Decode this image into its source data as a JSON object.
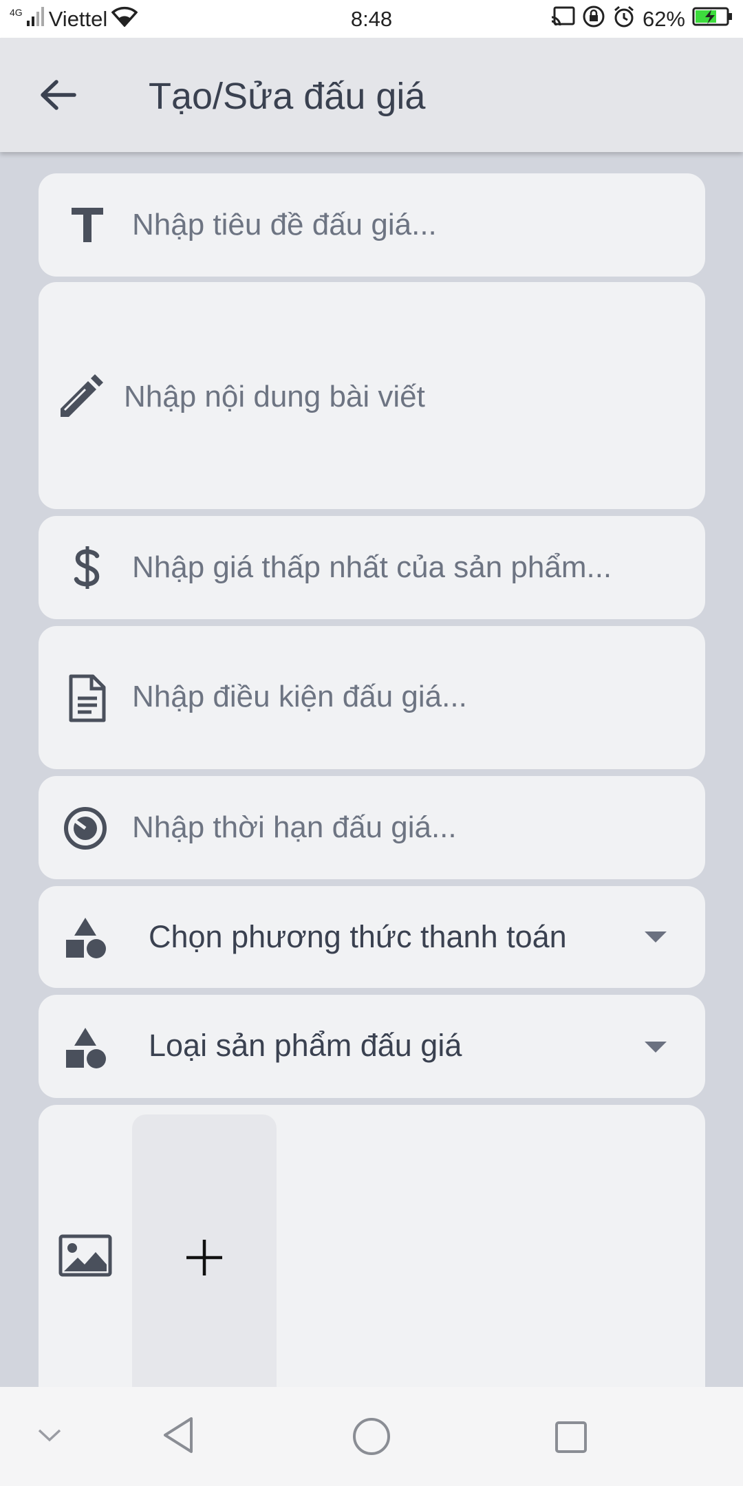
{
  "status_bar": {
    "network_type": "4G",
    "carrier": "Viettel",
    "time": "8:48",
    "battery": "62%",
    "icons": [
      "signal-icon",
      "wifi-icon",
      "cast-icon",
      "lock-rotation-icon",
      "alarm-icon",
      "battery-charging-icon"
    ]
  },
  "app_bar": {
    "title": "Tạo/Sửa đấu giá",
    "back_icon": "arrow-left-icon"
  },
  "form": {
    "title_field": {
      "placeholder": "Nhập tiêu đề đấu giá...",
      "icon": "text-format-icon"
    },
    "content_field": {
      "placeholder": "Nhập nội dung bài viết",
      "icon": "pencil-icon"
    },
    "price_field": {
      "placeholder": "Nhập giá thấp nhất của sản phẩm...",
      "icon": "dollar-icon"
    },
    "condition_field": {
      "placeholder": "Nhập điều kiện đấu giá...",
      "icon": "document-icon"
    },
    "duration_field": {
      "placeholder": "Nhập thời hạn đấu giá...",
      "icon": "timer-icon"
    },
    "payment_select": {
      "label": "Chọn phương thức thanh toán",
      "icon": "shapes-icon"
    },
    "category_select": {
      "label": "Loại sản phẩm đấu giá",
      "icon": "shapes-icon"
    },
    "images": {
      "icon": "image-icon",
      "add_icon": "plus-icon"
    }
  },
  "nav_bar": {
    "icons": [
      "chevron-down-icon",
      "back-triangle-icon",
      "home-circle-icon",
      "recents-square-icon"
    ]
  },
  "colors": {
    "background": "#d2d5dd",
    "card": "#f1f2f4",
    "app_bar": "#e4e5e9",
    "text_dark": "#3a4150",
    "placeholder": "#6d7482",
    "icon": "#4a505c",
    "battery_green": "#3ddc3d"
  }
}
